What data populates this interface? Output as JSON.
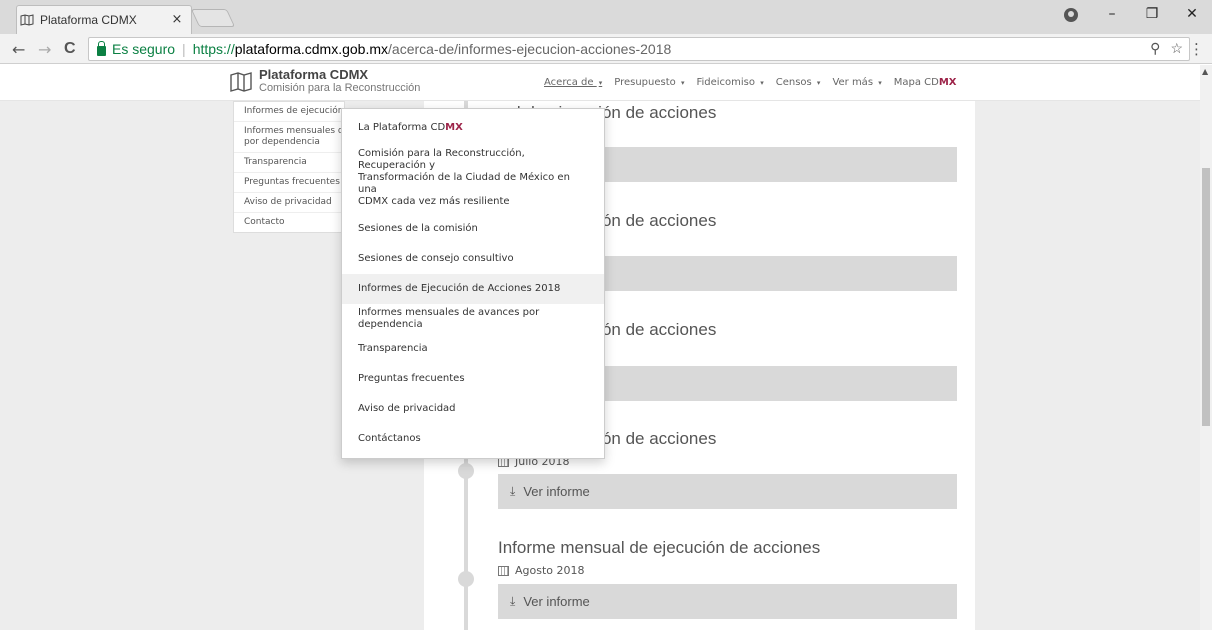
{
  "browser": {
    "tab_title": "Plataforma CDMX",
    "tab_close": "×",
    "secure_label": "Es seguro",
    "url_scheme": "https://",
    "url_host": "plataforma.cdmx.gob.mx",
    "url_path": "/acerca-de/informes-ejecucion-acciones-2018",
    "back": "←",
    "forward": "→",
    "reload": "C",
    "zoom": "⚲",
    "bookmark": "☆",
    "menu": "⋮",
    "minimize": "–",
    "maximize": "❐",
    "close": "✕"
  },
  "brand": {
    "title": "Plataforma CDMX",
    "subtitle": "Comisión para la Reconstrucción",
    "accent": "#9d2449"
  },
  "nav": {
    "items": [
      {
        "label": "Acerca de",
        "active": true
      },
      {
        "label": "Presupuesto"
      },
      {
        "label": "Fideicomiso"
      },
      {
        "label": "Censos"
      },
      {
        "label": "Ver más"
      }
    ],
    "map_label_a": "Mapa CD",
    "map_label_b": "MX",
    "caret": "▾"
  },
  "left_menu": {
    "items": [
      "Informes de ejecución",
      "Informes mensuales d",
      "por dependencia",
      "Transparencia",
      "Preguntas frecuentes",
      "Aviso de privacidad",
      "Contacto"
    ]
  },
  "dropdown": {
    "first_a": "La Plataforma CD",
    "first_b": "MX",
    "items": [
      "Comisión para la Reconstrucción, Recuperación y",
      "Transformación de la Ciudad de México en una",
      "CDMX cada vez más resiliente",
      "Sesiones de la comisión",
      "Sesiones de consejo consultivo",
      "Informes de Ejecución de Acciones 2018",
      "Informes mensuales de avances por dependencia",
      "Transparencia",
      "Preguntas frecuentes",
      "Aviso de privacidad",
      "Contáctanos"
    ]
  },
  "entries": {
    "partial_title": "ual de ejecución de acciones",
    "full_title": "Informe mensual de ejecución de acciones",
    "button_label": "Ver informe",
    "date_julio": "Julio 2018",
    "date_agosto": "Agosto 2018"
  }
}
